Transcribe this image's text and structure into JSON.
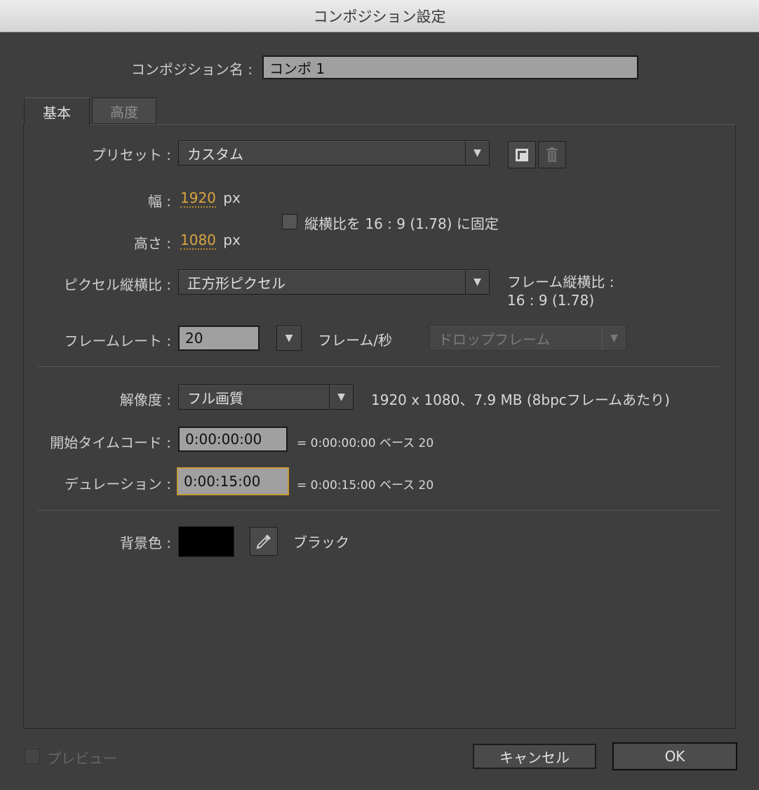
{
  "window": {
    "title": "コンポジション設定"
  },
  "comp_name": {
    "label": "コンポジション名 :",
    "value": "コンポ 1"
  },
  "tabs": [
    {
      "label": "基本",
      "active": true
    },
    {
      "label": "高度",
      "active": false
    }
  ],
  "preset": {
    "label": "プリセット :",
    "value": "カスタム",
    "save_icon": "save-preset-icon",
    "delete_icon": "trash-icon"
  },
  "width": {
    "label": "幅 :",
    "value": "1920",
    "unit": "px"
  },
  "height": {
    "label": "高さ :",
    "value": "1080",
    "unit": "px"
  },
  "aspect_lock": {
    "label": "縦横比を 16 : 9 (1.78) に固定",
    "checked": false
  },
  "pixel_aspect": {
    "label": "ピクセル縦横比 :",
    "value": "正方形ピクセル",
    "frame_aspect_label": "フレーム縦横比 :",
    "frame_aspect_value": "16 : 9 (1.78)"
  },
  "frame_rate": {
    "label": "フレームレート :",
    "value": "20",
    "unit": "フレーム/秒",
    "drop_frame": "ドロップフレーム"
  },
  "resolution": {
    "label": "解像度 :",
    "value": "フル画質",
    "info": "1920 x 1080、7.9 MB (8bpcフレームあたり)"
  },
  "start_timecode": {
    "label": "開始タイムコード :",
    "value": "0:00:00:00",
    "info": "= 0:00:00:00  ベース 20"
  },
  "duration": {
    "label": "デュレーション :",
    "value": "0:00:15:00",
    "info": "= 0:00:15:00  ベース 20"
  },
  "background": {
    "label": "背景色 :",
    "color": "#000000",
    "name": "ブラック",
    "eyedropper_icon": "eyedropper-icon"
  },
  "preview": {
    "label": "プレビュー",
    "checked": false
  },
  "buttons": {
    "cancel": "キャンセル",
    "ok": "OK"
  },
  "colors": {
    "accent": "#d9a540",
    "focus": "#c89a35",
    "bg": "#3e3e3e"
  }
}
